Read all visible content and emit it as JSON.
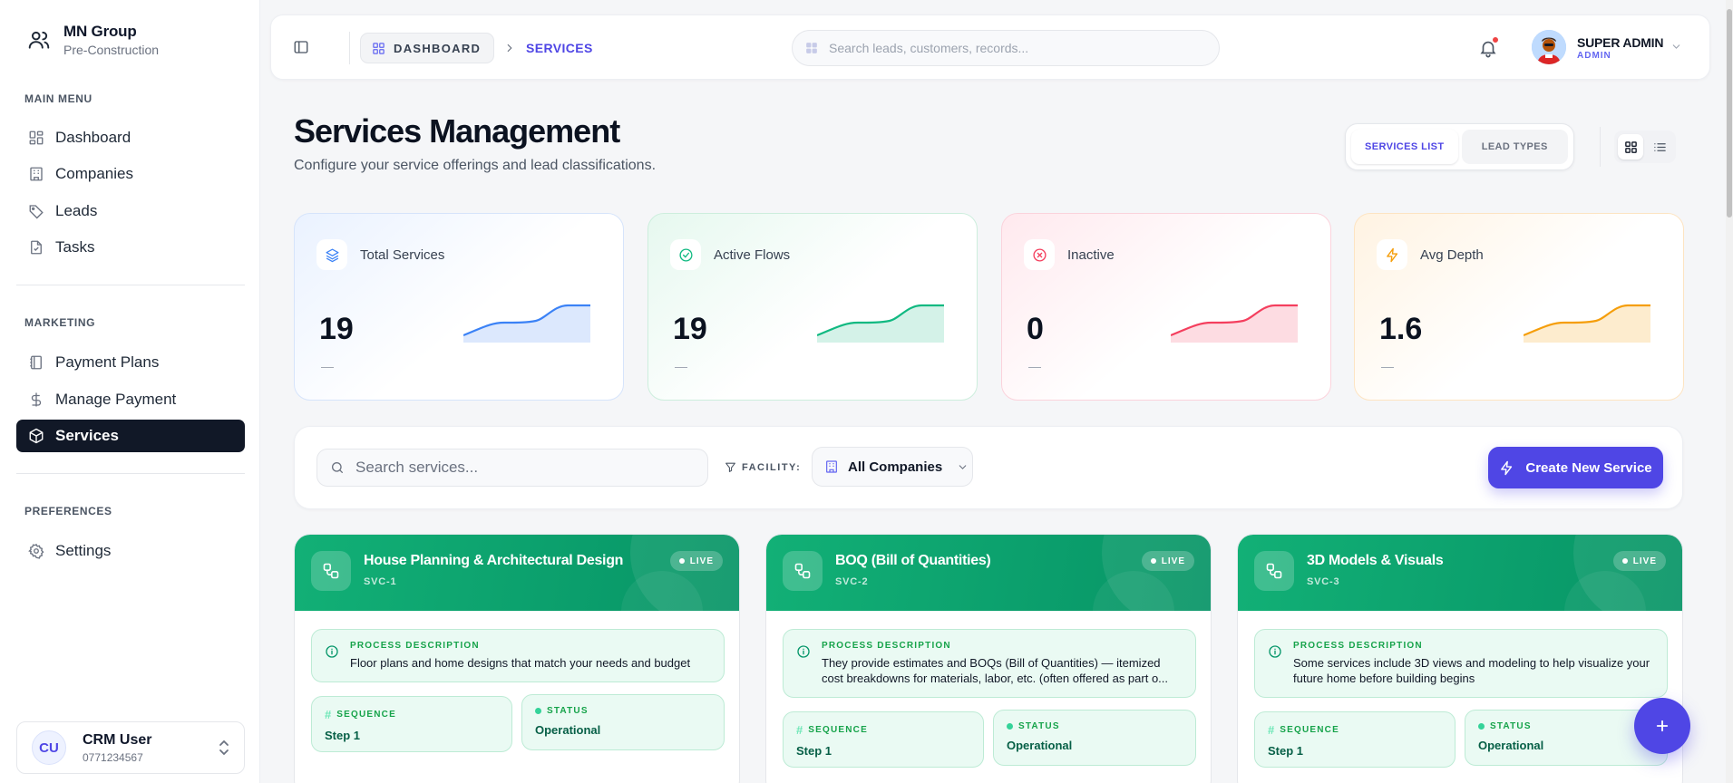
{
  "brand": {
    "name": "MN Group",
    "subtitle": "Pre-Construction"
  },
  "sidebar": {
    "sections": [
      {
        "title": "MAIN MENU"
      },
      {
        "title": "MARKETING"
      },
      {
        "title": "PREFERENCES"
      }
    ],
    "items": [
      {
        "label": "Dashboard",
        "icon": "dashboard-icon"
      },
      {
        "label": "Companies",
        "icon": "building-icon"
      },
      {
        "label": "Leads",
        "icon": "tag-icon"
      },
      {
        "label": "Tasks",
        "icon": "file-check-icon"
      },
      {
        "label": "Payment Plans",
        "icon": "notebook-icon"
      },
      {
        "label": "Manage Payment",
        "icon": "dollar-icon"
      },
      {
        "label": "Services",
        "icon": "box-icon",
        "active": true
      },
      {
        "label": "Settings",
        "icon": "gear-icon"
      }
    ],
    "user": {
      "initials": "CU",
      "name": "CRM User",
      "phone": "0771234567"
    }
  },
  "header": {
    "breadcrumb": [
      "DASHBOARD",
      "SERVICES"
    ],
    "search_placeholder": "Search leads, customers, records...",
    "user": {
      "name": "SUPER ADMIN",
      "role": "ADMIN"
    }
  },
  "page": {
    "title": "Services Management",
    "subtitle": "Configure your service offerings and lead classifications.",
    "tabs": [
      "SERVICES LIST",
      "LEAD TYPES"
    ],
    "active_tab": "SERVICES LIST",
    "view_mode": "grid"
  },
  "stats": [
    {
      "label": "Total Services",
      "value": "19",
      "trend": "—",
      "color": "#3b82f6",
      "icon": "layers-icon"
    },
    {
      "label": "Active Flows",
      "value": "19",
      "trend": "—",
      "color": "#10b981",
      "icon": "check-circle-icon"
    },
    {
      "label": "Inactive",
      "value": "0",
      "trend": "—",
      "color": "#f43f5e",
      "icon": "x-circle-icon"
    },
    {
      "label": "Avg Depth",
      "value": "1.6",
      "trend": "—",
      "color": "#f59e0b",
      "icon": "zap-icon"
    }
  ],
  "filters": {
    "search_placeholder": "Search services...",
    "facility_label": "FACILITY:",
    "facility_value": "All Companies",
    "create_label": "Create New Service"
  },
  "services": [
    {
      "title": "House Planning & Architectural Design",
      "code": "SVC-1",
      "badge": "LIVE",
      "desc_label": "PROCESS DESCRIPTION",
      "description": "Floor plans and home designs that match your needs and budget",
      "sequence_label": "SEQUENCE",
      "sequence": "Step 1",
      "status_label": "STATUS",
      "status": "Operational"
    },
    {
      "title": "BOQ (Bill of Quantities)",
      "code": "SVC-2",
      "badge": "LIVE",
      "desc_label": "PROCESS DESCRIPTION",
      "description": "They provide estimates and BOQs (Bill of Quantities) — itemized cost breakdowns for materials, labor, etc. (often offered as part o...",
      "sequence_label": "SEQUENCE",
      "sequence": "Step 1",
      "status_label": "STATUS",
      "status": "Operational"
    },
    {
      "title": "3D Models & Visuals",
      "code": "SVC-3",
      "badge": "LIVE",
      "desc_label": "PROCESS DESCRIPTION",
      "description": "Some services include 3D views and modeling to help visualize your future home before building begins",
      "sequence_label": "SEQUENCE",
      "sequence": "Step 1",
      "status_label": "STATUS",
      "status": "Operational"
    }
  ],
  "colors": {
    "accent": "#4f46e5",
    "sidebar_active": "#111827",
    "card_header": "#0f9f6e"
  }
}
